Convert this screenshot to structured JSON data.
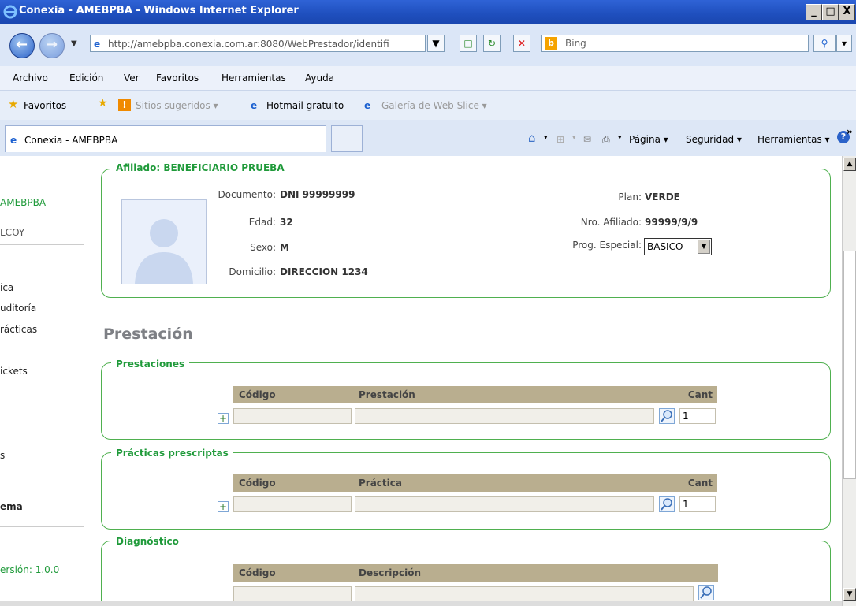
{
  "window": {
    "title": "Conexia - AMEBPBA - Windows Internet Explorer",
    "min": "_",
    "max": "□",
    "close": "X"
  },
  "addressbar": {
    "url": "http://amebpba.conexia.com.ar:8080/WebPrestador/identifi",
    "search_placeholder": "Bing"
  },
  "menubar": [
    "Archivo",
    "Edición",
    "Ver",
    "Favoritos",
    "Herramientas",
    "Ayuda"
  ],
  "favorites": {
    "label": "Favoritos",
    "items": [
      "Sitios sugeridos ▾",
      "Hotmail gratuito",
      "Galería de Web Slice ▾"
    ]
  },
  "tabbar": {
    "tab_label": "Conexia - AMEBPBA",
    "commands": [
      "Página ▾",
      "Seguridad ▾",
      "Herramientas ▾"
    ],
    "overflow": "»"
  },
  "sidebar": {
    "org": "AMEBPBA",
    "user": "LCOY",
    "links": [
      "ica",
      "uditoría",
      "rácticas",
      "ickets",
      "s"
    ],
    "system": "ema",
    "version": "ersión:  1.0.0"
  },
  "afiliado": {
    "legend": "Afiliado: BENEFICIARIO PRUEBA",
    "documento_label": "Documento:",
    "documento": "DNI 99999999",
    "edad_label": "Edad:",
    "edad": "32",
    "sexo_label": "Sexo:",
    "sexo": "M",
    "domicilio_label": "Domicilio:",
    "domicilio": "DIRECCION 1234",
    "plan_label": "Plan:",
    "plan": "VERDE",
    "nro_label": "Nro. Afiliado:",
    "nro": "99999/9/9",
    "prog_label": "Prog. Especial:",
    "prog": "BASICO"
  },
  "section_title": "Prestación",
  "prestaciones": {
    "legend": "Prestaciones",
    "col_codigo": "Código",
    "col_desc": "Prestación",
    "col_cant": "Cant",
    "qty": "1"
  },
  "practicas": {
    "legend": "Prácticas prescriptas",
    "col_codigo": "Código",
    "col_desc": "Práctica",
    "col_cant": "Cant",
    "qty": "1"
  },
  "diagnostico": {
    "legend": "Diagnóstico",
    "col_codigo": "Código",
    "col_desc": "Descripción"
  }
}
